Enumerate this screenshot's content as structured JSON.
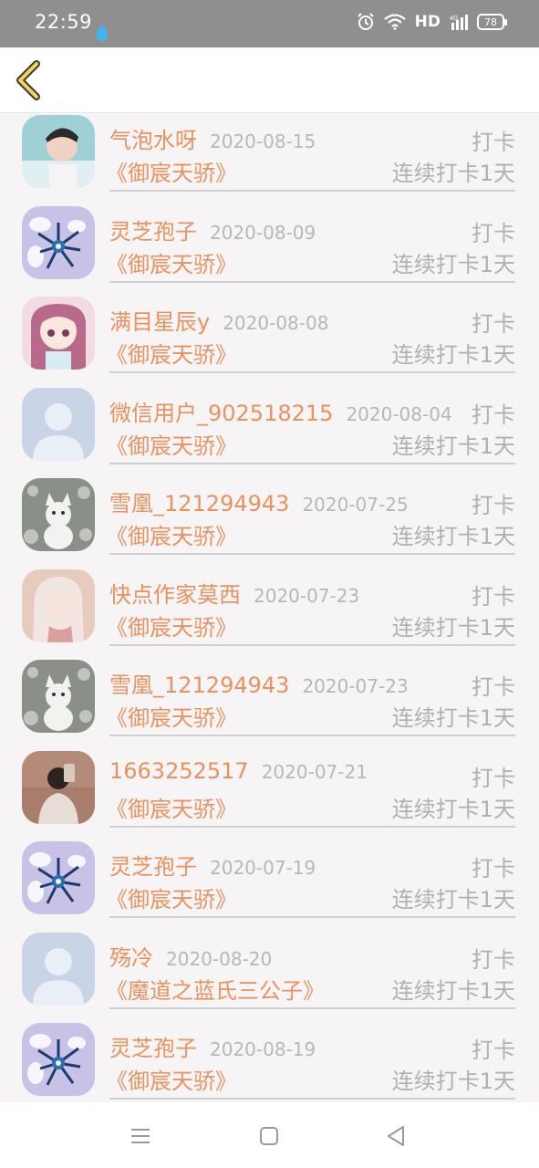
{
  "status_bar": {
    "time": "22:59",
    "network": "HD",
    "battery": "78"
  },
  "header": {
    "back_icon": "chevron-left-icon"
  },
  "items": [
    {
      "name": "气泡水呀",
      "date": "2020-08-15",
      "action": "打卡",
      "book": "《御宸天骄》",
      "streak": "连续打卡1天",
      "avatar": "photo-boy"
    },
    {
      "name": "灵芝孢子",
      "date": "2020-08-09",
      "action": "打卡",
      "book": "《御宸天骄》",
      "streak": "连续打卡1天",
      "avatar": "flower"
    },
    {
      "name": "满目星辰y",
      "date": "2020-08-08",
      "action": "打卡",
      "book": "《御宸天骄》",
      "streak": "连续打卡1天",
      "avatar": "anime-girl"
    },
    {
      "name": "微信用户_902518215",
      "date": "2020-08-04",
      "action": "打卡",
      "book": "《御宸天骄》",
      "streak": "连续打卡1天",
      "avatar": "default"
    },
    {
      "name": "雪凰_121294943",
      "date": "2020-07-25",
      "action": "打卡",
      "book": "《御宸天骄》",
      "streak": "连续打卡1天",
      "avatar": "cat"
    },
    {
      "name": "快点作家莫西",
      "date": "2020-07-23",
      "action": "打卡",
      "book": "《御宸天骄》",
      "streak": "连续打卡1天",
      "avatar": "pink-girl"
    },
    {
      "name": "雪凰_121294943",
      "date": "2020-07-23",
      "action": "打卡",
      "book": "《御宸天骄》",
      "streak": "连续打卡1天",
      "avatar": "cat"
    },
    {
      "name": "1663252517",
      "date": "2020-07-21",
      "action": "打卡",
      "book": "《御宸天骄》",
      "streak": "连续打卡1天",
      "avatar": "selfie"
    },
    {
      "name": "灵芝孢子",
      "date": "2020-07-19",
      "action": "打卡",
      "book": "《御宸天骄》",
      "streak": "连续打卡1天",
      "avatar": "flower"
    },
    {
      "name": "殇冷",
      "date": "2020-08-20",
      "action": "打卡",
      "book": "《魔道之蓝氏三公子》",
      "streak": "连续打卡1天",
      "avatar": "default"
    },
    {
      "name": "灵芝孢子",
      "date": "2020-08-19",
      "action": "打卡",
      "book": "《御宸天骄》",
      "streak": "连续打卡1天",
      "avatar": "flower"
    }
  ],
  "nav_bar": {
    "menu_icon": "menu-icon",
    "home_icon": "home-icon",
    "back_icon": "back-triangle-icon"
  },
  "colors": {
    "accent": "#e8925f",
    "muted": "#b0b0b0",
    "status_bar": "#8f8f8f"
  }
}
